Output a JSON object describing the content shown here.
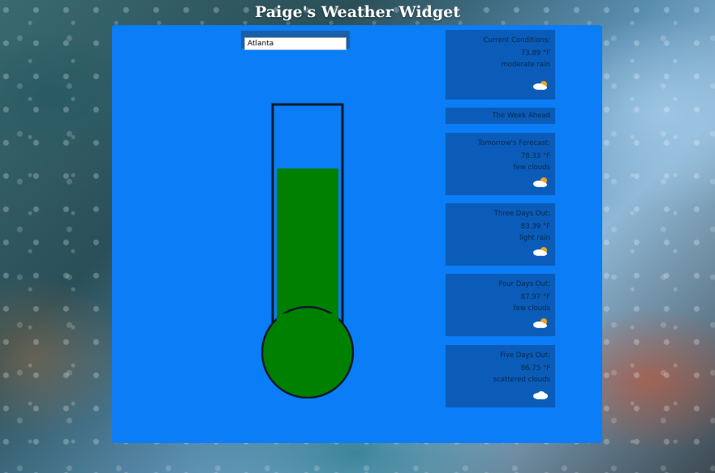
{
  "app": {
    "title": "Paige's Weather Widget"
  },
  "search": {
    "value": "Atlanta"
  },
  "thermometer": {
    "fill_fraction": 0.74,
    "fill_color": "#008000"
  },
  "current": {
    "title": "Current Conditions:",
    "temp": "73.89 °F",
    "desc": "moderate rain",
    "icon": "rain-cloud-sun-icon"
  },
  "week_header": "The Week Ahead",
  "forecast": [
    {
      "title": "Tomorrow's Forecast:",
      "temp": "78.33 °F",
      "desc": "few clouds",
      "icon": "cloud-sun-icon"
    },
    {
      "title": "Three Days Out:",
      "temp": "83.39 °F",
      "desc": "light rain",
      "icon": "rain-cloud-sun-icon"
    },
    {
      "title": "Four Days Out:",
      "temp": "87.97 °F",
      "desc": "few clouds",
      "icon": "cloud-sun-icon"
    },
    {
      "title": "Five Days Out:",
      "temp": "86.75 °F",
      "desc": "scattered clouds",
      "icon": "cloud-icon"
    }
  ],
  "colors": {
    "panel": "#0a7df7",
    "card": "#0b5cb8",
    "card_text": "#03284d"
  }
}
